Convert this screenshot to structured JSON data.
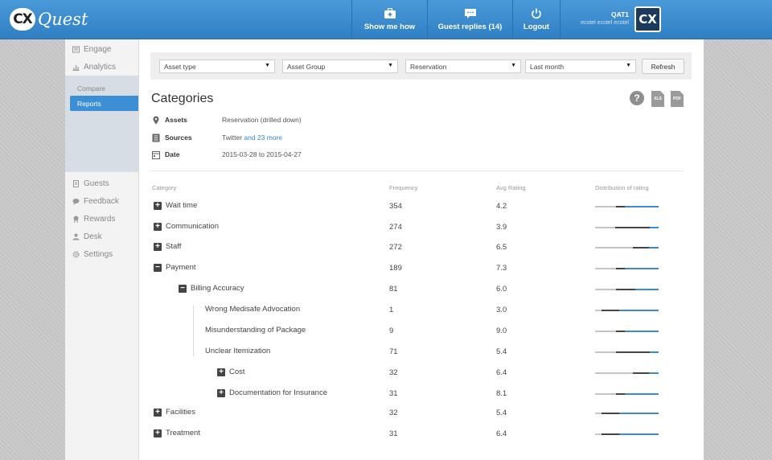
{
  "app": {
    "logo_badge": "CX",
    "logo_text": "Quest"
  },
  "topnav": [
    {
      "label": "Show me how",
      "icon": "briefcase-plus-icon"
    },
    {
      "label": "Guest replies (14)",
      "icon": "chat-bubble-icon"
    },
    {
      "label": "Logout",
      "icon": "power-icon"
    }
  ],
  "user": {
    "name": "QAT1",
    "org": "ecotel ecotel ecotel",
    "avatar": "CX"
  },
  "sidebar": {
    "items_top": [
      {
        "label": "Engage",
        "icon": "engage-icon"
      },
      {
        "label": "Analytics",
        "icon": "analytics-icon"
      }
    ],
    "sub_items": [
      {
        "label": "Compare",
        "active": false
      },
      {
        "label": "Reports",
        "active": true
      }
    ],
    "items_bottom": [
      {
        "label": "Guests",
        "icon": "guests-icon"
      },
      {
        "label": "Feedback",
        "icon": "feedback-icon"
      },
      {
        "label": "Rewards",
        "icon": "rewards-icon"
      },
      {
        "label": "Desk",
        "icon": "desk-icon"
      },
      {
        "label": "Settings",
        "icon": "settings-icon"
      }
    ]
  },
  "filters": {
    "asset_type": "Asset type",
    "asset_group": "Asset Group",
    "asset": "Reservation",
    "period": "Last month",
    "refresh": "Refresh"
  },
  "page": {
    "title": "Categories",
    "help": "?",
    "xls": "XLS",
    "pdf": "PDF"
  },
  "meta": {
    "assets_label": "Assets",
    "assets_value": "Reservation (drilled down)",
    "sources_label": "Sources",
    "sources_value": "Twitter",
    "sources_more": "and 23 more",
    "date_label": "Date",
    "date_value": "2015-03-28 to 2015-04-27"
  },
  "table": {
    "headers": {
      "category": "Category",
      "frequency": "Frequency",
      "avg_rating": "Avg Rating",
      "distribution": "Distribution of rating"
    },
    "rows": [
      {
        "name": "Wait time",
        "freq": "354",
        "rating": "4.2",
        "toggle": "+",
        "level": 0,
        "dist": [
          0.33,
          0.14,
          0.53
        ]
      },
      {
        "name": "Communication",
        "freq": "274",
        "rating": "3.9",
        "toggle": "+",
        "level": 0,
        "dist": [
          0.32,
          0.54,
          0.14
        ]
      },
      {
        "name": "Staff",
        "freq": "272",
        "rating": "6.5",
        "toggle": "+",
        "level": 0,
        "dist": [
          0.6,
          0.25,
          0.15
        ]
      },
      {
        "name": "Payment",
        "freq": "189",
        "rating": "7.3",
        "toggle": "−",
        "level": 0,
        "dist": [
          0.33,
          0.14,
          0.53
        ]
      },
      {
        "name": "Billing Accuracy",
        "freq": "81",
        "rating": "6.0",
        "toggle": "−",
        "level": 1,
        "dist": [
          0.33,
          0.3,
          0.37
        ]
      },
      {
        "name": "Wrong Medisafe Advocation",
        "freq": "1",
        "rating": "3.0",
        "toggle": "",
        "level": 2,
        "dist": [
          0.1,
          0.28,
          0.62
        ]
      },
      {
        "name": "Misunderstanding of Package",
        "freq": "9",
        "rating": "9.0",
        "toggle": "",
        "level": 2,
        "dist": [
          0.33,
          0.14,
          0.53
        ]
      },
      {
        "name": "Unclear Itemization",
        "freq": "71",
        "rating": "5.4",
        "toggle": "",
        "level": 2,
        "dist": [
          0.33,
          0.53,
          0.14
        ]
      },
      {
        "name": "Cost",
        "freq": "32",
        "rating": "6.4",
        "toggle": "+",
        "level": 3,
        "dist": [
          0.6,
          0.25,
          0.15
        ]
      },
      {
        "name": "Documentation for Insurance",
        "freq": "31",
        "rating": "8.1",
        "toggle": "+",
        "level": 3,
        "dist": [
          0.33,
          0.14,
          0.53
        ]
      },
      {
        "name": "Facilities",
        "freq": "32",
        "rating": "5.4",
        "toggle": "+",
        "level": 0,
        "dist": [
          0.1,
          0.28,
          0.62
        ]
      },
      {
        "name": "Treatment",
        "freq": "31",
        "rating": "6.4",
        "toggle": "+",
        "level": 0,
        "dist": [
          0.1,
          0.28,
          0.62
        ]
      }
    ]
  },
  "colors": {
    "low": "#c4c4c4",
    "mid": "#444444",
    "high": "#3d8ad2",
    "accent": "#3c8fd4"
  }
}
